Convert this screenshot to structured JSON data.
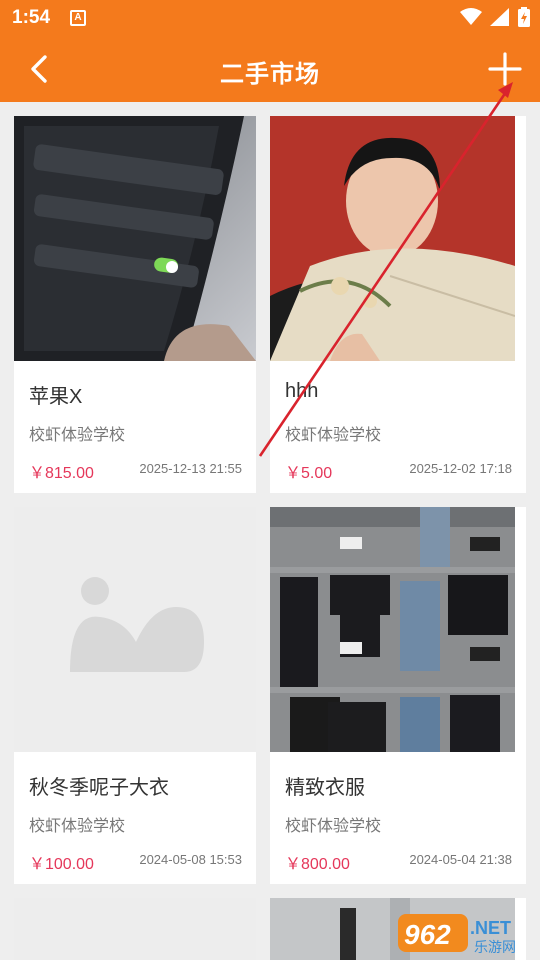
{
  "status_bar": {
    "time": "1:54",
    "notification_icon_letter": "A"
  },
  "app_bar": {
    "title": "二手市场",
    "back_icon": "chevron-left",
    "add_icon": "plus"
  },
  "items": [
    {
      "name": "苹果X",
      "school": "校虾体验学校",
      "price": "￥815.00",
      "date": "2025-12-13 21:55",
      "image": "phone-battery-settings-photo"
    },
    {
      "name": "hhh",
      "school": "校虾体验学校",
      "price": "￥5.00",
      "date": "2025-12-02 17:18",
      "image": "portrait-with-fan-photo"
    },
    {
      "name": "秋冬季呢子大衣",
      "school": "校虾体验学校",
      "price": "￥100.00",
      "date": "2024-05-08 15:53",
      "image": "placeholder-image"
    },
    {
      "name": "精致衣服",
      "school": "校虾体验学校",
      "price": "￥800.00",
      "date": "2024-05-04 21:38",
      "image": "clothes-flatlay-photo"
    }
  ],
  "watermark": {
    "text": "962.NET",
    "subtext": "乐游网"
  },
  "colors": {
    "primary": "#f47a1c",
    "price": "#e5375a",
    "background": "#eeeeee",
    "annotation_arrow": "#d9232d"
  }
}
